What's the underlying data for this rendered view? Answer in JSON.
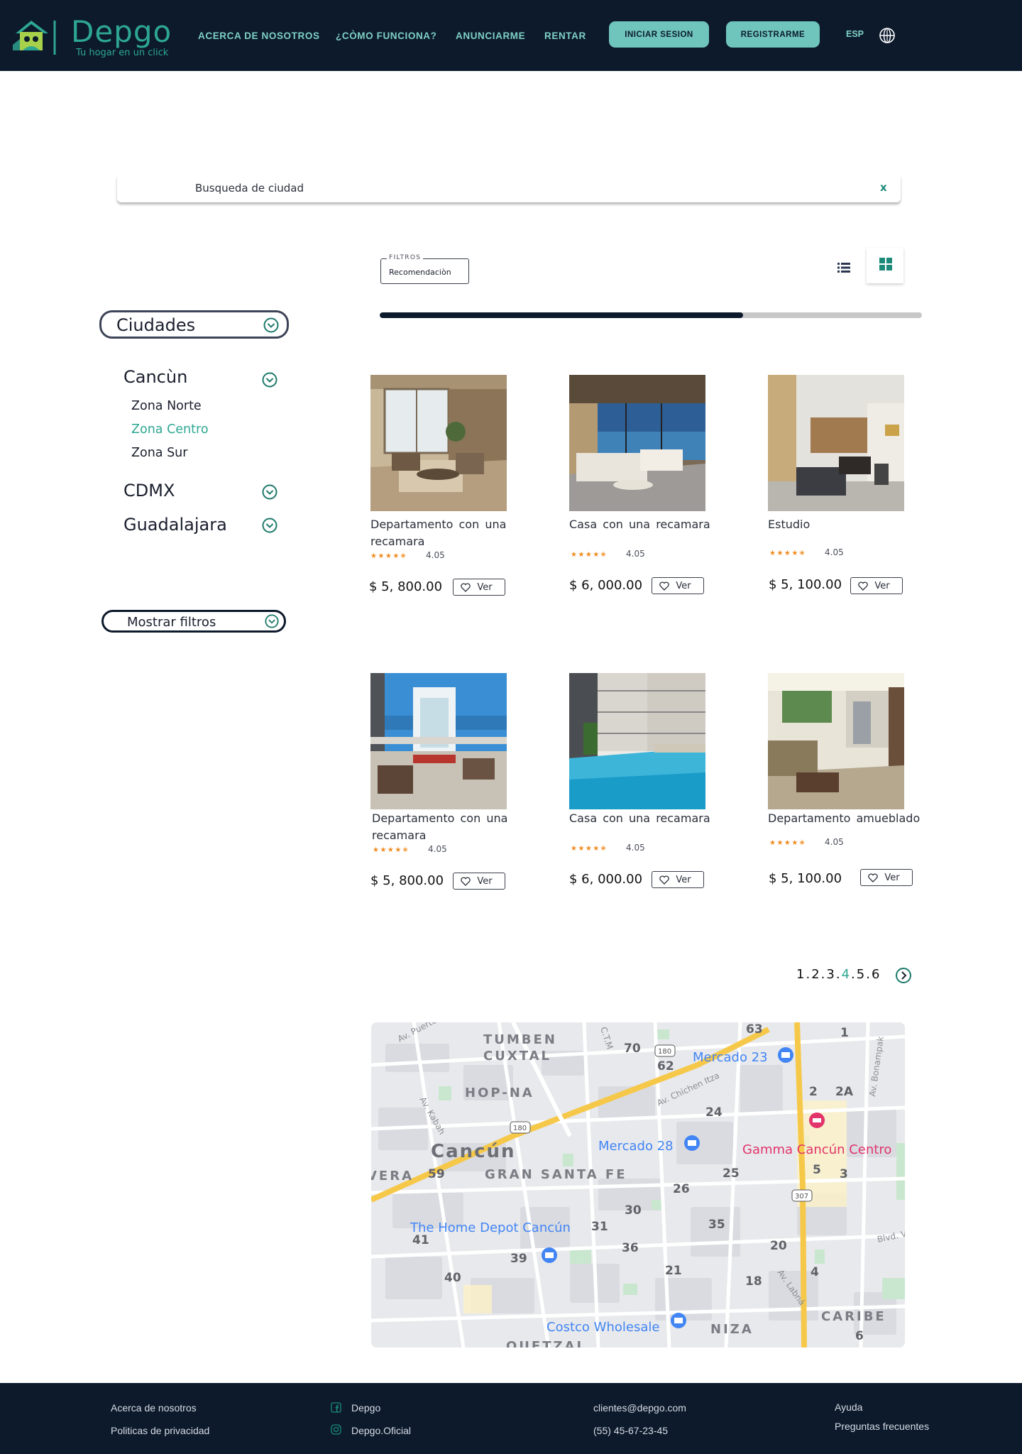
{
  "header": {
    "brand": "Depgo",
    "tagline": "Tu hogar en un click",
    "nav": [
      "ACERCA DE NOSOTROS",
      "¿CÒMO FUNCIONA?",
      "ANUNCIARME",
      "RENTAR"
    ],
    "login_label": "INICIAR SESION",
    "register_label": "REGISTRARME",
    "language": "ESP",
    "colors": {
      "background": "#0c1a2c",
      "accent": "#2ea792",
      "button": "#6fc4bb"
    }
  },
  "search": {
    "value": "Busqueda de ciudad",
    "clear_label": "x"
  },
  "filters": {
    "legend": "FILTROS",
    "sort_value": "Recomendaciòn",
    "progress_fraction": 0.67,
    "views": [
      "list-view-icon",
      "grid-view-icon"
    ]
  },
  "sidebar": {
    "cities_label": "Ciudades",
    "cities": [
      {
        "name": "Cancùn",
        "zones": [
          "Zona Norte",
          "Zona Centro",
          "Zona Sur"
        ],
        "active_zone": "Zona Centro"
      },
      {
        "name": "CDMX",
        "zones": []
      },
      {
        "name": "Guadalajara",
        "zones": []
      }
    ],
    "show_filters_label": "Mostrar filtros"
  },
  "listings": [
    {
      "title": "Departamento  con una recamara",
      "rating": "4.05",
      "stars": 4.5,
      "price": "$ 5, 800.00",
      "action": "Ver",
      "image": "living-room-beige"
    },
    {
      "title": "Casa  con una recamara",
      "rating": "4.05",
      "stars": 4.5,
      "price": "$ 6, 000.00",
      "action": "Ver",
      "image": "living-room-ocean-view"
    },
    {
      "title": "Estudio",
      "rating": "4.05",
      "stars": 4.5,
      "price": "$ 5, 100.00",
      "action": "Ver",
      "image": "studio-dining"
    },
    {
      "title": "Departamento  con una recamara",
      "rating": "4.05",
      "stars": 4.5,
      "price": "$ 5, 800.00",
      "action": "Ver",
      "image": "terrace-sea-view"
    },
    {
      "title": "Casa  con una recamara",
      "rating": "4.05",
      "stars": 4.5,
      "price": "$ 6, 000.00",
      "action": "Ver",
      "image": "pool"
    },
    {
      "title": "Departamento amueblado",
      "rating": "4.05",
      "stars": 4.5,
      "price": "$ 5, 100.00",
      "action": "Ver",
      "image": "furnished-apartment"
    }
  ],
  "pagination": {
    "pages": [
      "1",
      "2",
      "3",
      "4",
      "5",
      "6"
    ],
    "current": "4"
  },
  "map": {
    "labels": [
      "TUMBEN",
      "CUXTAL",
      "HOP-NA",
      "Cancún",
      "GRAN SANTA FE",
      "VERA",
      "NIZA",
      "CARIBE",
      "QUETZAL"
    ],
    "streets": [
      "Av. Puerto",
      "C.T.M",
      "Av. Chichen Itza",
      "Av. Kabah",
      "Av. Bonampak",
      "Av. Labná",
      "Blvd. V"
    ],
    "places": [
      "Mercado 23",
      "Mercado 28",
      "Gamma Cancún Centro",
      "The Home Depot Cancún",
      "Costco Wholesale"
    ],
    "highway_shields": [
      "180",
      "180",
      "307"
    ],
    "block_numbers": [
      "63",
      "1",
      "70",
      "62",
      "2",
      "2A",
      "24",
      "25",
      "5",
      "3",
      "59",
      "26",
      "30",
      "31",
      "35",
      "41",
      "36",
      "20",
      "39",
      "21",
      "4",
      "40",
      "18",
      "6"
    ]
  },
  "footer": {
    "col1": [
      "Acerca de nosotros",
      "Politicas de privacidad"
    ],
    "col2": [
      {
        "label": "Depgo",
        "icon": "facebook-icon"
      },
      {
        "label": "Depgo.Oficial",
        "icon": "instagram-icon"
      }
    ],
    "col3": [
      "clientes@depgo.com",
      "(55) 45-67-23-45"
    ],
    "col4": [
      "Ayuda",
      "Preguntas frecuentes"
    ]
  }
}
